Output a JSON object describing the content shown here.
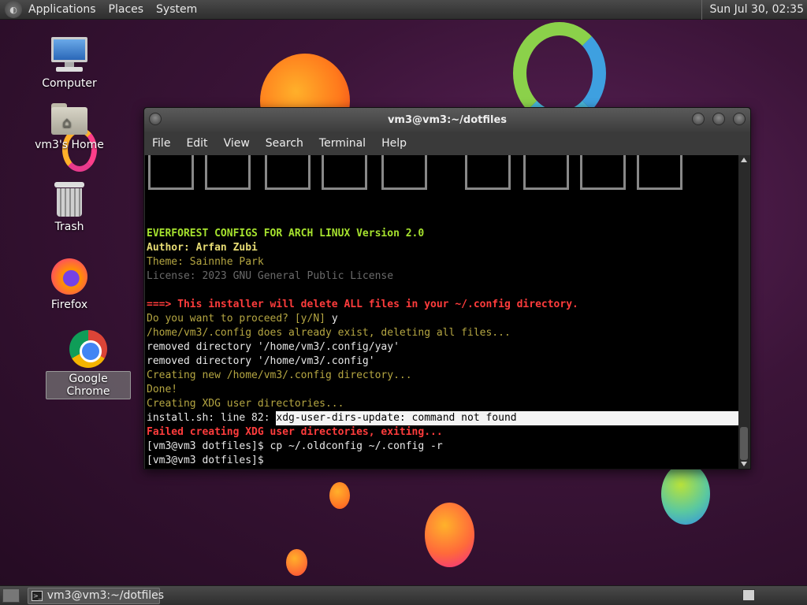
{
  "top_panel": {
    "menus": [
      "Applications",
      "Places",
      "System"
    ],
    "clock": "Sun Jul 30, 02:35"
  },
  "desktop_icons": {
    "computer": "Computer",
    "home": "vm3's Home",
    "trash": "Trash",
    "firefox": "Firefox",
    "chrome": "Google Chrome"
  },
  "window": {
    "title": "vm3@vm3:~/dotfiles",
    "menu": [
      "File",
      "Edit",
      "View",
      "Search",
      "Terminal",
      "Help"
    ]
  },
  "terminal": {
    "lines": [
      "EVERFOREST CONFIGS FOR ARCH LINUX Version 2.0",
      "Author: Arfan Zubi",
      "Theme: Sainnhe Park",
      "License: 2023 GNU General Public License",
      "===> This installer will delete ALL files in your ~/.config directory.",
      "Do you want to proceed? [y/N] ",
      "y",
      "/home/vm3/.config does already exist, deleting all files...",
      "removed directory '/home/vm3/.config/yay'",
      "removed directory '/home/vm3/.config'",
      "Creating new /home/vm3/.config directory...",
      "Done!",
      "Creating XDG user directories...",
      "install.sh: line 82: ",
      "xdg-user-dirs-update: command not found",
      "Failed creating XDG user directories, exiting...",
      "[vm3@vm3 dotfiles]$ cp ~/.oldconfig ~/.config -r",
      "[vm3@vm3 dotfiles]$ "
    ]
  },
  "taskbar": {
    "task_label": "vm3@vm3:~/dotfiles"
  },
  "colors": {
    "green": "#a6e22e",
    "yellow": "#e6db74",
    "red": "#ff3c3c"
  }
}
